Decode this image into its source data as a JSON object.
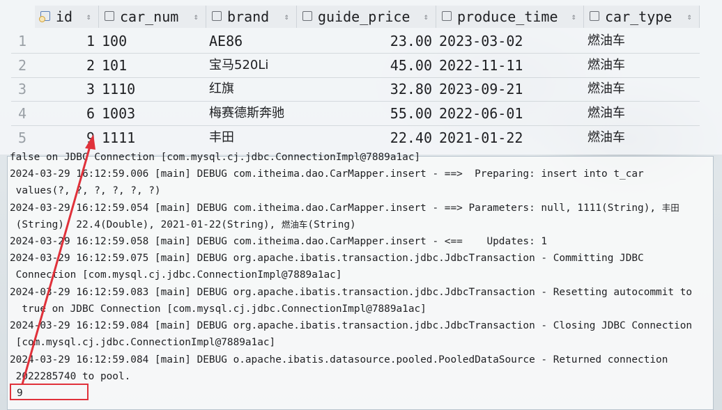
{
  "table": {
    "columns": [
      {
        "label": "id",
        "icon": "primary-key-icon"
      },
      {
        "label": "car_num",
        "icon": "column-icon"
      },
      {
        "label": "brand",
        "icon": "column-icon"
      },
      {
        "label": "guide_price",
        "icon": "column-icon"
      },
      {
        "label": "produce_time",
        "icon": "column-icon"
      },
      {
        "label": "car_type",
        "icon": "column-icon"
      }
    ],
    "sort_glyph": "⇕",
    "rows": [
      {
        "n": "1",
        "id": "1",
        "car_num": "100",
        "brand": "AE86",
        "guide_price": "23.00",
        "produce_time": "2023-03-02",
        "car_type": "燃油车"
      },
      {
        "n": "2",
        "id": "2",
        "car_num": "101",
        "brand": "宝马520Li",
        "guide_price": "45.00",
        "produce_time": "2022-11-11",
        "car_type": "燃油车"
      },
      {
        "n": "3",
        "id": "3",
        "car_num": "1110",
        "brand": "红旗",
        "guide_price": "32.80",
        "produce_time": "2023-09-21",
        "car_type": "燃油车"
      },
      {
        "n": "4",
        "id": "6",
        "car_num": "1003",
        "brand": "梅赛德斯奔驰",
        "guide_price": "55.00",
        "produce_time": "2022-06-01",
        "car_type": "燃油车"
      },
      {
        "n": "5",
        "id": "9",
        "car_num": "1111",
        "brand": "丰田",
        "guide_price": "22.40",
        "produce_time": "2021-01-22",
        "car_type": "燃油车"
      }
    ]
  },
  "console": {
    "lines": [
      "false on JDBC Connection [com.mysql.cj.jdbc.ConnectionImpl@7889a1ac]",
      "2024-03-29 16:12:59.006 [main] DEBUG com.itheima.dao.CarMapper.insert - ==>  Preparing: insert into t_car",
      " values(?, ?, ?, ?, ?, ?)",
      "2024-03-29 16:12:59.054 [main] DEBUG com.itheima.dao.CarMapper.insert - ==> Parameters: null, 1111(String), ",
      " (String), 22.4(Double), 2021-01-22(String), ",
      "2024-03-29 16:12:59.058 [main] DEBUG com.itheima.dao.CarMapper.insert - <==    Updates: 1",
      "2024-03-29 16:12:59.075 [main] DEBUG org.apache.ibatis.transaction.jdbc.JdbcTransaction - Committing JDBC",
      " Connection [com.mysql.cj.jdbc.ConnectionImpl@7889a1ac]",
      "2024-03-29 16:12:59.083 [main] DEBUG org.apache.ibatis.transaction.jdbc.JdbcTransaction - Resetting autocommit to",
      "  true on JDBC Connection [com.mysql.cj.jdbc.ConnectionImpl@7889a1ac]",
      "2024-03-29 16:12:59.084 [main] DEBUG org.apache.ibatis.transaction.jdbc.JdbcTransaction - Closing JDBC Connection",
      " [com.mysql.cj.jdbc.ConnectionImpl@7889a1ac]",
      "2024-03-29 16:12:59.084 [main] DEBUG o.apache.ibatis.datasource.pooled.PooledDataSource - Returned connection",
      " 2022285740 to pool."
    ],
    "line4_tail_cjk": "丰田",
    "line5_tail_cjk": "燃油车",
    "line5_tail_suffix": "(String)",
    "result_value": "9"
  },
  "annotation": {
    "box_color": "#e0313a",
    "arrow_color": "#e0313a"
  }
}
